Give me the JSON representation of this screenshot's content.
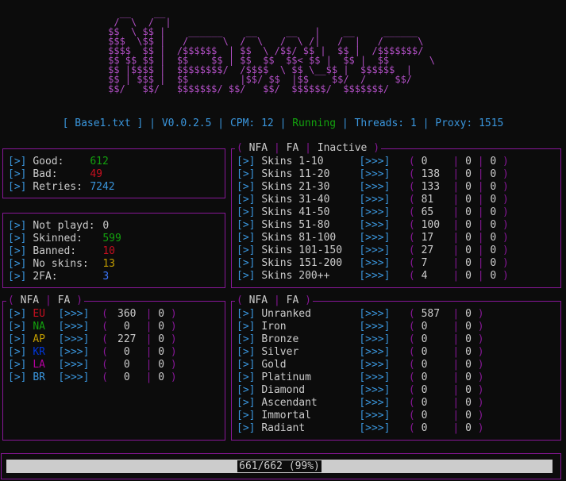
{
  "banner": [
    "       __    __",
    "      /  \\  /  |",
    "     $$  \\ $$ |    ______    __     __   |    __     ______",
    "     $$$  \\$$ |   /      \\  /  \\   /  \\ /|   /  |   /      \\",
    "     $$$$  $$ |  /$$$$$$  | $$  \\ /$$/ $$ |  $$ |  /$$$$$$$/",
    "     $$ $$ $$ |  $$    $$ | $$  $$  $$< $$ |  $$ |  $$       \\",
    "     $$ |$$$$ |  $$$$$$$$/  /$$$$  \\ $$ \\__$$ |  $$$$$$  |",
    "     $$ | $$$ |  $$         |$$/ $$  |$$    $$/  /     $$/",
    "     $$/   $$/   $$$$$$$/ $$/   $$/  $$$$$$/  $$$$$$$/"
  ],
  "status": {
    "file": "Base1.txt",
    "version": "V0.0.2.5",
    "cpm_label": "CPM:",
    "cpm": "12",
    "state": "Running",
    "threads_label": "Threads:",
    "threads": "1",
    "proxy_label": "Proxy:",
    "proxy": "1515"
  },
  "results": {
    "good_label": "Good:",
    "good": "612",
    "bad_label": "Bad:",
    "bad": "49",
    "retries_label": "Retries:",
    "retries": "7242"
  },
  "stats": {
    "not_played_label": "Not playd:",
    "not_played": "0",
    "skinned_label": "Skinned:",
    "skinned": "599",
    "banned_label": "Banned:",
    "banned": "10",
    "no_skins_label": "No skins:",
    "no_skins": "13",
    "twofa_label": "2FA:",
    "twofa": "3"
  },
  "skins_box": {
    "nfa": "NFA",
    "fa": "FA",
    "inactive": "Inactive",
    "rows": [
      {
        "label": "Skins 1-10",
        "a": "0",
        "b": "0",
        "c": "0"
      },
      {
        "label": "Skins 11-20",
        "a": "138",
        "b": "0",
        "c": "0"
      },
      {
        "label": "Skins 21-30",
        "a": "133",
        "b": "0",
        "c": "0"
      },
      {
        "label": "Skins 31-40",
        "a": "81",
        "b": "0",
        "c": "0"
      },
      {
        "label": "Skins 41-50",
        "a": "65",
        "b": "0",
        "c": "0"
      },
      {
        "label": "Skins 51-80",
        "a": "100",
        "b": "0",
        "c": "0"
      },
      {
        "label": "Skins 81-100",
        "a": "17",
        "b": "0",
        "c": "0"
      },
      {
        "label": "Skins 101-150",
        "a": "27",
        "b": "0",
        "c": "0"
      },
      {
        "label": "Skins 151-200",
        "a": "7",
        "b": "0",
        "c": "0"
      },
      {
        "label": "Skins 200++",
        "a": "4",
        "b": "0",
        "c": "0"
      }
    ]
  },
  "region_box": {
    "nfa": "NFA",
    "fa": "FA",
    "rows": [
      {
        "label": "EU",
        "color": "#c50f1f",
        "a": "360",
        "b": "0"
      },
      {
        "label": "NA",
        "color": "#13a10e",
        "a": "0",
        "b": "0"
      },
      {
        "label": "AP",
        "color": "#c19c00",
        "a": "227",
        "b": "0"
      },
      {
        "label": "KR",
        "color": "#0037da",
        "a": "0",
        "b": "0"
      },
      {
        "label": "LA",
        "color": "#b4009e",
        "a": "0",
        "b": "0"
      },
      {
        "label": "BR",
        "color": "#3a96dd",
        "a": "0",
        "b": "0"
      }
    ]
  },
  "rank_box": {
    "nfa": "NFA",
    "fa": "FA",
    "rows": [
      {
        "label": "Unranked",
        "a": "587",
        "b": "0"
      },
      {
        "label": "Iron",
        "a": "0",
        "b": "0"
      },
      {
        "label": "Bronze",
        "a": "0",
        "b": "0"
      },
      {
        "label": "Silver",
        "a": "0",
        "b": "0"
      },
      {
        "label": "Gold",
        "a": "0",
        "b": "0"
      },
      {
        "label": "Platinum",
        "a": "0",
        "b": "0"
      },
      {
        "label": "Diamond",
        "a": "0",
        "b": "0"
      },
      {
        "label": "Ascendant",
        "a": "0",
        "b": "0"
      },
      {
        "label": "Immortal",
        "a": "0",
        "b": "0"
      },
      {
        "label": "Radiant",
        "a": "0",
        "b": "0"
      }
    ]
  },
  "progress": {
    "done": 661,
    "total": 662,
    "text": "661/662 (99%)"
  },
  "symbols": {
    "bracket_arrow": "[>]",
    "chevrons": "[>>>]"
  },
  "colors": {
    "border": "#881798",
    "cyan": "#3a96dd",
    "green": "#13a10e",
    "red": "#c50f1f",
    "yellow": "#c19c00",
    "blue": "#3b78ff"
  }
}
